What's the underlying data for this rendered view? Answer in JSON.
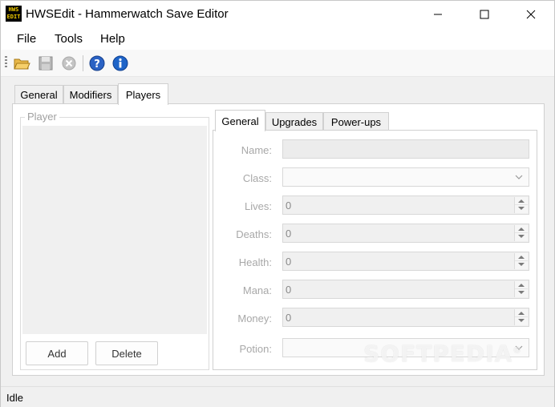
{
  "window": {
    "title": "HWSEdit - Hammerwatch Save Editor",
    "icon_text": [
      "HWS",
      "EDIT"
    ]
  },
  "menu": {
    "items": [
      "File",
      "Tools",
      "Help"
    ]
  },
  "toolbar": {
    "icons": [
      "open-folder-icon",
      "save-icon",
      "close-file-icon",
      "help-icon",
      "info-icon"
    ]
  },
  "main_tabs": [
    "General",
    "Modifiers",
    "Players"
  ],
  "player_group": {
    "title": "Player",
    "add_label": "Add",
    "delete_label": "Delete"
  },
  "sub_tabs": [
    "General",
    "Upgrades",
    "Power-ups"
  ],
  "fields": {
    "name": {
      "label": "Name:",
      "value": ""
    },
    "class": {
      "label": "Class:",
      "value": ""
    },
    "lives": {
      "label": "Lives:",
      "value": "0"
    },
    "deaths": {
      "label": "Deaths:",
      "value": "0"
    },
    "health": {
      "label": "Health:",
      "value": "0"
    },
    "mana": {
      "label": "Mana:",
      "value": "0"
    },
    "money": {
      "label": "Money:",
      "value": "0"
    },
    "potion": {
      "label": "Potion:",
      "value": ""
    }
  },
  "status": {
    "text": "Idle"
  },
  "watermark": "SOFTPEDIA",
  "watermark_mark": "®",
  "colors": {
    "disabled_label": "#a8a8a8",
    "info_blue": "#1e64c8"
  }
}
